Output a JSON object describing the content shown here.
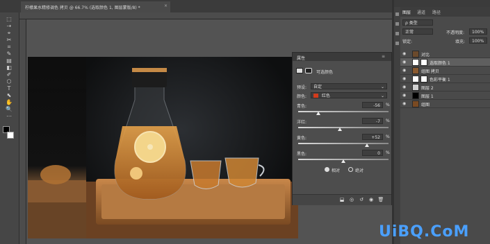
{
  "document": {
    "tab_title": "柠檬果水精修调色 拷贝 @ 66.7% (选取颜色 1, 图层蒙版/8) *",
    "close_glyph": "×"
  },
  "tools": [
    "⬚",
    "⇢",
    "⌖",
    "✂",
    "⌗",
    "✎",
    "▤",
    "◧",
    "✐",
    "⬡",
    "T",
    "⬉",
    "✋",
    "🔍",
    "⋯"
  ],
  "layers_panel": {
    "tabs": [
      "图层",
      "通道",
      "路径"
    ],
    "filter_label": "ρ 类型",
    "blend_mode": "正常",
    "opacity_label": "不透明度:",
    "opacity_value": "100%",
    "lock_label": "锁定:",
    "fill_label": "填充:",
    "fill_value": "100%",
    "layers": [
      {
        "name": "对比",
        "selected": false
      },
      {
        "name": "选取颜色 1",
        "selected": true
      },
      {
        "name": "组图 拷贝",
        "selected": false
      },
      {
        "name": "色彩平衡 1",
        "selected": false
      },
      {
        "name": "图层 2",
        "selected": false
      },
      {
        "name": "图层 1",
        "selected": false
      },
      {
        "name": "组图",
        "selected": false
      }
    ]
  },
  "properties_panel": {
    "title": "属性",
    "adjustment_name": "可选颜色",
    "preset_label": "预设:",
    "preset_value": "自定",
    "colors_label": "颜色:",
    "colors_value": "红色",
    "channels": [
      {
        "label": "青色:",
        "value": "-56",
        "unit": "%",
        "level": 0.22
      },
      {
        "label": "洋红:",
        "value": "-7",
        "unit": "%",
        "level": 0.465
      },
      {
        "label": "黄色:",
        "value": "+52",
        "unit": "%",
        "level": 0.76
      },
      {
        "label": "黑色:",
        "value": "0",
        "unit": "%",
        "level": 0.5
      }
    ],
    "mode_relative": "相对",
    "mode_absolute": "绝对"
  },
  "watermark": "UiBQ.CoM"
}
